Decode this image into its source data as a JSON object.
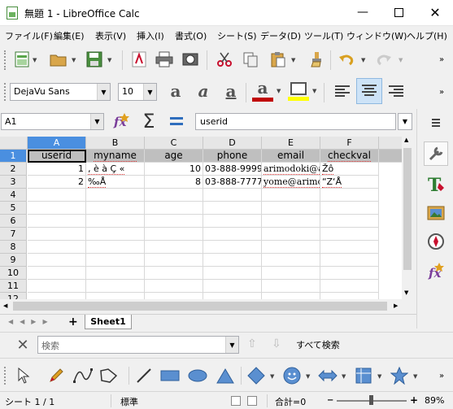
{
  "window": {
    "title": "無題 1 - LibreOffice Calc"
  },
  "menubar": {
    "items": [
      "ファイル(F)",
      "編集(E)",
      "表示(V)",
      "挿入(I)",
      "書式(O)",
      "シート(S)",
      "データ(D)",
      "ツール(T)",
      "ウィンドウ(W)",
      "ヘルプ(H)"
    ]
  },
  "format_toolbar": {
    "font_name": "DejaVu Sans",
    "font_size": "10"
  },
  "formula_bar": {
    "cell_ref": "A1",
    "content": "userid"
  },
  "sheet": {
    "columns": [
      "A",
      "B",
      "C",
      "D",
      "E",
      "F"
    ],
    "rows": [
      "1",
      "2",
      "3",
      "4",
      "5",
      "6",
      "7",
      "8",
      "9",
      "10",
      "11",
      "12"
    ],
    "headers": [
      "userid",
      "myname",
      "age",
      "phone",
      "email",
      "checkval"
    ],
    "data": [
      [
        "1",
        "‚ è à Ç «",
        "10",
        "03-888-9999",
        "arimodoki@ar",
        "Žô"
      ],
      [
        "2",
        "‰Å",
        "8",
        "03-888-7777",
        "yome@arimo",
        "“Z‘Å"
      ]
    ]
  },
  "tabs": {
    "active": "Sheet1",
    "add_label": "+"
  },
  "find": {
    "placeholder": "検索",
    "search_all_label": "すべて検索"
  },
  "status": {
    "sheet_info": "シート 1 / 1",
    "page_style": "標準",
    "sum": "合計=0",
    "zoom": "89%"
  },
  "colors": {
    "selection": "#4a8fe0",
    "header_fill": "#bfbfbf",
    "font_color_bar": "#c00000",
    "highlight_bar": "#ffff00"
  }
}
